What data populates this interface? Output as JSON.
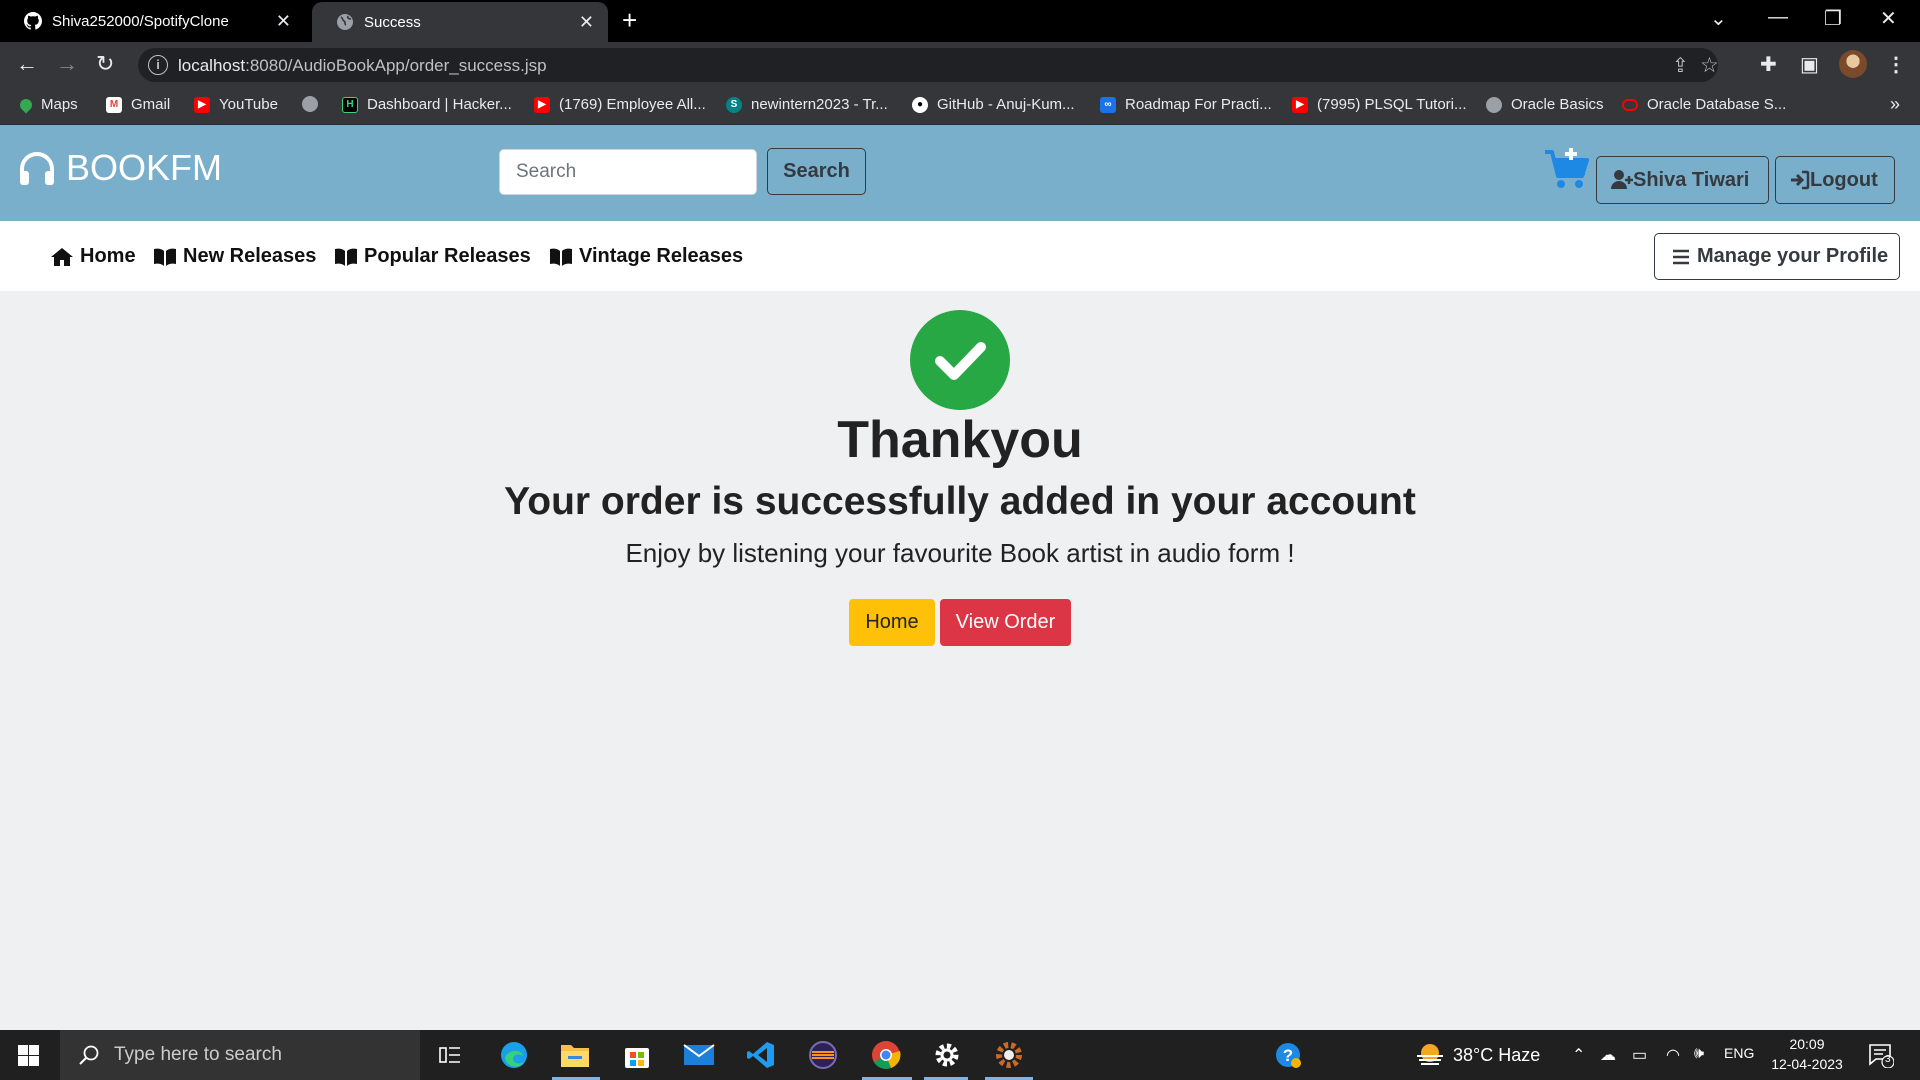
{
  "browser": {
    "tabs": [
      {
        "title": "Shiva252000/SpotifyClone",
        "icon": "github-icon",
        "active": false
      },
      {
        "title": "Success",
        "icon": "globe-icon",
        "active": true
      }
    ],
    "url_host": "localhost",
    "url_path": ":8080/AudioBookApp/order_success.jsp",
    "bookmarks": [
      {
        "label": "Maps",
        "icon": "maps-icon",
        "color": "#34a853"
      },
      {
        "label": "Gmail",
        "icon": "gmail-icon",
        "color": "#ea4335"
      },
      {
        "label": "YouTube",
        "icon": "youtube-icon",
        "color": "#ff0000"
      },
      {
        "label": "",
        "icon": "globe-icon",
        "color": "#9aa0a6"
      },
      {
        "label": "Dashboard | Hacker...",
        "icon": "hackerrank-icon",
        "color": "#000000"
      },
      {
        "label": "(1769) Employee All...",
        "icon": "youtube-icon",
        "color": "#ff0000"
      },
      {
        "label": "newintern2023 - Tr...",
        "icon": "sharepoint-icon",
        "color": "#038387"
      },
      {
        "label": "GitHub - Anuj-Kum...",
        "icon": "github-icon",
        "color": "#ffffff"
      },
      {
        "label": "Roadmap For Practi...",
        "icon": "infinity-icon",
        "color": "#1a73e8"
      },
      {
        "label": "(7995) PLSQL Tutori...",
        "icon": "youtube-icon",
        "color": "#ff0000"
      },
      {
        "label": "Oracle Basics",
        "icon": "globe-icon",
        "color": "#9aa0a6"
      },
      {
        "label": "Oracle Database S...",
        "icon": "oracle-icon",
        "color": "#f80000"
      }
    ]
  },
  "header": {
    "brand": "BOOKFM",
    "search_placeholder": "Search",
    "search_button": "Search",
    "user_label": "Shiva Tiwari",
    "logout_label": "Logout"
  },
  "nav": {
    "items": [
      {
        "label": "Home",
        "icon": "home-icon"
      },
      {
        "label": "New Releases",
        "icon": "book-icon"
      },
      {
        "label": "Popular Releases",
        "icon": "book-icon"
      },
      {
        "label": "Vintage Releases",
        "icon": "book-icon"
      }
    ],
    "manage_profile": "Manage your Profile"
  },
  "main": {
    "heading": "Thankyou",
    "message": "Your order is successfully added in your account",
    "subtext": "Enjoy by listening your favourite Book artist in audio form !",
    "home_button": "Home",
    "view_order_button": "View Order"
  },
  "taskbar": {
    "search_placeholder": "Type here to search",
    "weather": "38°C  Haze",
    "language": "ENG",
    "time": "20:09",
    "date": "12-04-2023",
    "notification_count": "3"
  },
  "colors": {
    "header_bg": "#7aafcc",
    "success": "#28a745",
    "home_button": "#ffc107",
    "view_order_button": "#dc3545"
  }
}
